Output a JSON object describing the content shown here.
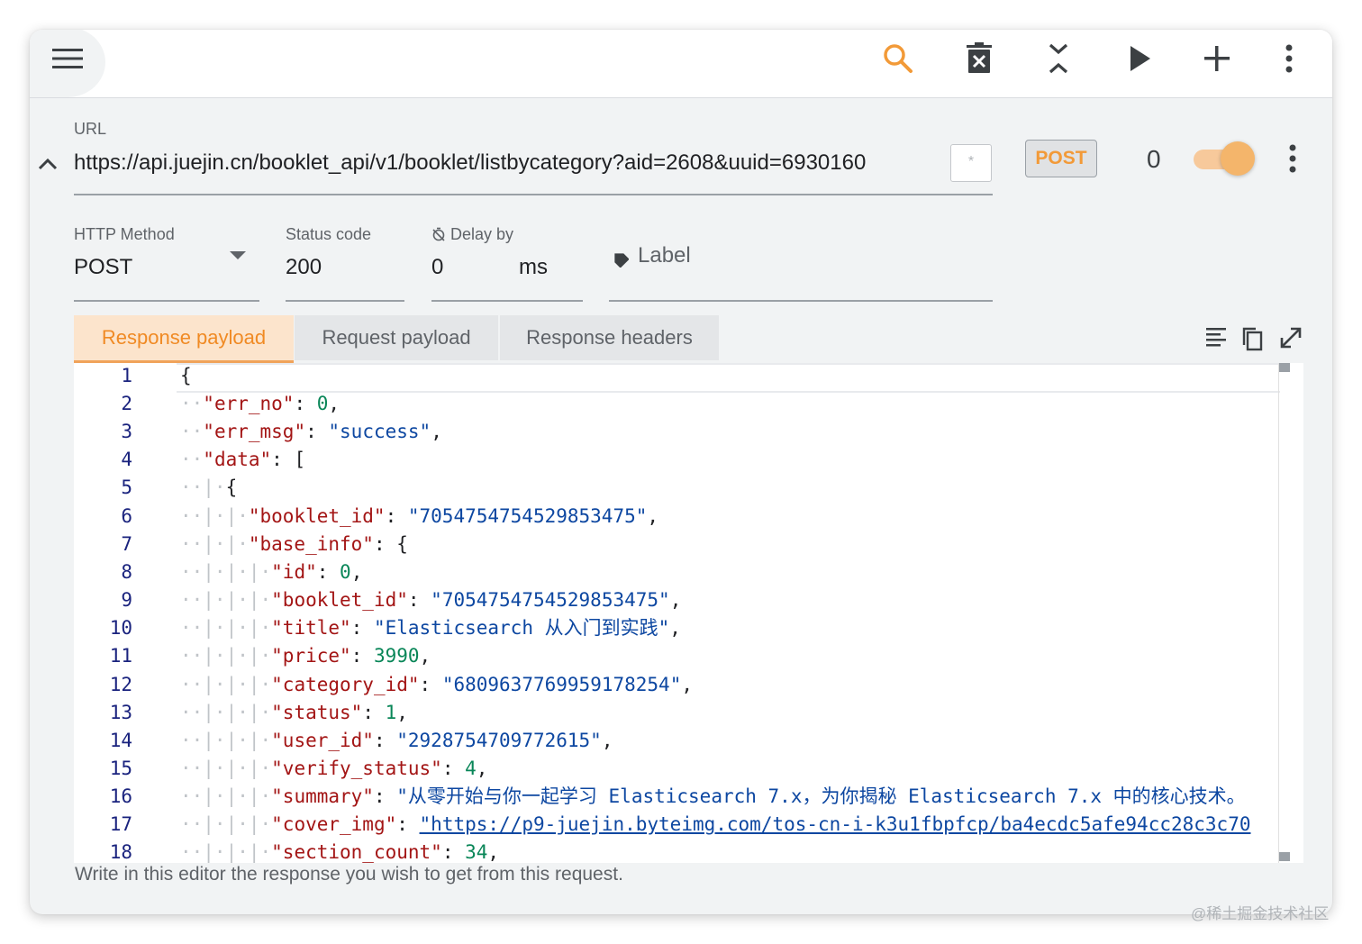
{
  "toolbar": {
    "menu_icon": "hamburger-menu-icon",
    "icons": [
      "search-icon",
      "delete-icon",
      "collapse-all-icon",
      "play-icon",
      "add-icon",
      "more-vert-icon"
    ],
    "accent": "#f29a38"
  },
  "request": {
    "url_label": "URL",
    "url_value": "https://api.juejin.cn/booklet_api/v1/booklet/listbycategory?aid=2608&uuid=6930160",
    "method_badge": "POST",
    "count": "0",
    "toggle_on": true
  },
  "fields": {
    "http_method_label": "HTTP Method",
    "http_method_value": "POST",
    "status_code_label": "Status code",
    "status_code_value": "200",
    "delay_label": "Delay by",
    "delay_value": "0",
    "delay_unit": "ms",
    "label_placeholder": "Label"
  },
  "tabs": {
    "response_payload": "Response payload",
    "request_payload": "Request payload",
    "response_headers": "Response headers",
    "active": "Response payload"
  },
  "editor": {
    "line_numbers": [
      "1",
      "2",
      "3",
      "4",
      "5",
      "6",
      "7",
      "8",
      "9",
      "10",
      "11",
      "12",
      "13",
      "14",
      "15",
      "16",
      "17",
      "18"
    ],
    "line_1": "{",
    "line_2": {
      "key": "\"err_no\"",
      "sep": ": ",
      "value": "0",
      "end": ","
    },
    "line_3": {
      "key": "\"err_msg\"",
      "sep": ": ",
      "value": "\"success\"",
      "end": ","
    },
    "line_4": {
      "key": "\"data\"",
      "sep": ": ",
      "value": "["
    },
    "line_5": "{",
    "line_6": {
      "key": "\"booklet_id\"",
      "sep": ": ",
      "value": "\"7054754754529853475\"",
      "end": ","
    },
    "line_7": {
      "key": "\"base_info\"",
      "sep": ": ",
      "value": "{"
    },
    "line_8": {
      "key": "\"id\"",
      "sep": ": ",
      "value": "0",
      "end": ","
    },
    "line_9": {
      "key": "\"booklet_id\"",
      "sep": ": ",
      "value": "\"7054754754529853475\"",
      "end": ","
    },
    "line_10": {
      "key": "\"title\"",
      "sep": ": ",
      "value": "\"Elasticsearch 从入门到实践\"",
      "end": ","
    },
    "line_11": {
      "key": "\"price\"",
      "sep": ": ",
      "value": "3990",
      "end": ","
    },
    "line_12": {
      "key": "\"category_id\"",
      "sep": ": ",
      "value": "\"6809637769959178254\"",
      "end": ","
    },
    "line_13": {
      "key": "\"status\"",
      "sep": ": ",
      "value": "1",
      "end": ","
    },
    "line_14": {
      "key": "\"user_id\"",
      "sep": ": ",
      "value": "\"2928754709772615\"",
      "end": ","
    },
    "line_15": {
      "key": "\"verify_status\"",
      "sep": ": ",
      "value": "4",
      "end": ","
    },
    "line_16": {
      "key": "\"summary\"",
      "sep": ": ",
      "value": "\"从零开始与你一起学习 Elasticsearch 7.x，为你揭秘 Elasticsearch 7.x 中的核心技术。"
    },
    "line_17": {
      "key": "\"cover_img\"",
      "sep": ": ",
      "value": "\"https://p9-juejin.byteimg.com/tos-cn-i-k3u1fbpfcp/ba4ecdc5afe94cc28c3c70"
    },
    "line_18": {
      "key": "\"section_count\"",
      "sep": ": ",
      "value": "34",
      "end": ","
    }
  },
  "helper_text": "Write in this editor the response you wish to get from this request.",
  "watermark": "@稀土掘金技术社区"
}
